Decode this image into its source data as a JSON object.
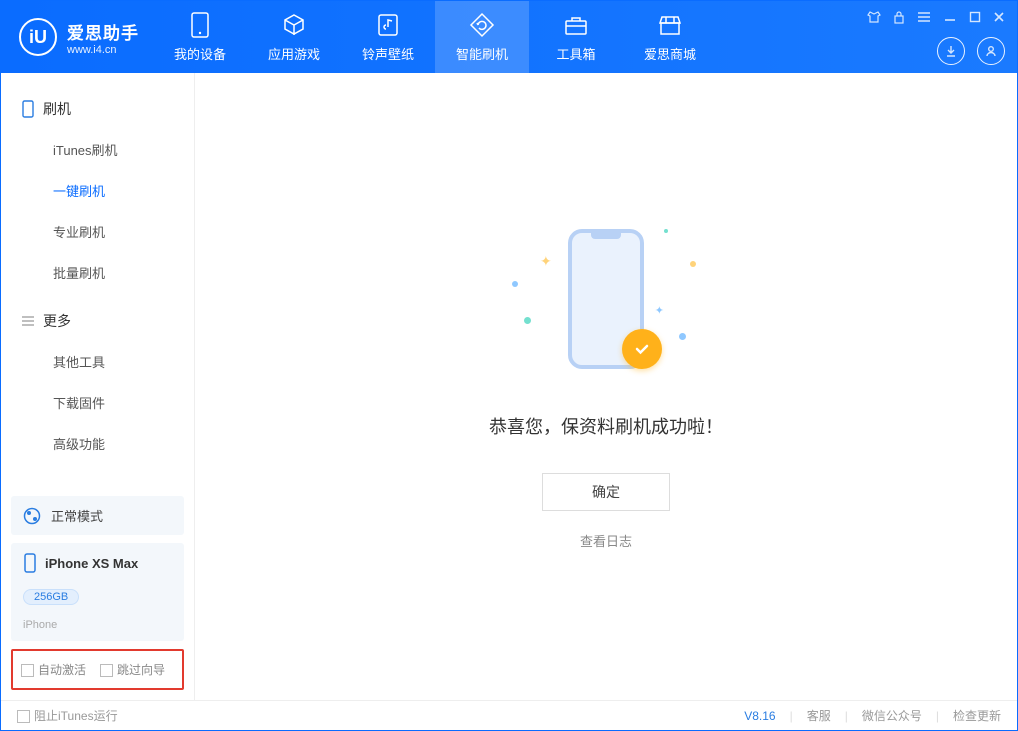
{
  "app": {
    "title": "爱思助手",
    "subtitle": "www.i4.cn"
  },
  "tabs": [
    {
      "label": "我的设备",
      "icon": "device"
    },
    {
      "label": "应用游戏",
      "icon": "cube"
    },
    {
      "label": "铃声壁纸",
      "icon": "music"
    },
    {
      "label": "智能刷机",
      "icon": "refresh"
    },
    {
      "label": "工具箱",
      "icon": "toolbox"
    },
    {
      "label": "爱思商城",
      "icon": "store"
    }
  ],
  "sidebar": {
    "group1": {
      "title": "刷机"
    },
    "items1": [
      "iTunes刷机",
      "一键刷机",
      "专业刷机",
      "批量刷机"
    ],
    "group2": {
      "title": "更多"
    },
    "items2": [
      "其他工具",
      "下载固件",
      "高级功能"
    ],
    "mode": "正常模式",
    "device": {
      "name": "iPhone XS Max",
      "storage": "256GB",
      "type": "iPhone"
    },
    "checks": {
      "auto_activate": "自动激活",
      "skip_guide": "跳过向导"
    }
  },
  "main": {
    "message": "恭喜您，保资料刷机成功啦！",
    "ok": "确定",
    "view_log": "查看日志"
  },
  "footer": {
    "block_itunes": "阻止iTunes运行",
    "version": "V8.16",
    "support": "客服",
    "wechat": "微信公众号",
    "update": "检查更新"
  }
}
